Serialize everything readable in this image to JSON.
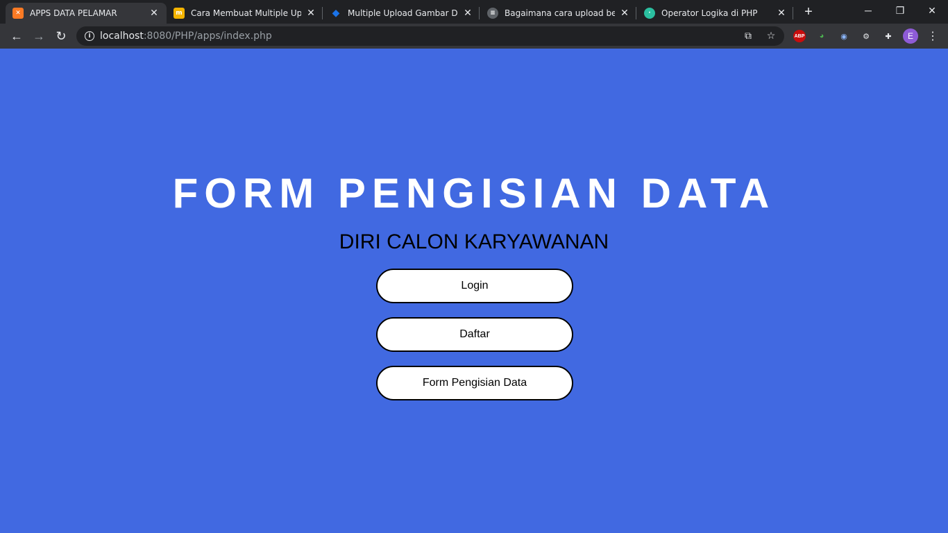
{
  "browser": {
    "tabs": [
      {
        "title": "APPS DATA PELAMAR",
        "favicon": "xampp-icon",
        "color": "#fb7a24",
        "active": true
      },
      {
        "title": "Cara Membuat Multiple Uploa",
        "favicon": "malas-ngoding-icon",
        "color": "#f4b400",
        "active": false
      },
      {
        "title": "Multiple Upload Gambar Deng",
        "favicon": "diamond-icon",
        "color": "#1a73e8",
        "active": false
      },
      {
        "title": "Bagaimana cara upload bebera",
        "favicon": "stackoverflow-icon",
        "color": "#5f6368",
        "active": false
      },
      {
        "title": "Operator Logika di PHP",
        "favicon": "globe-icon",
        "color": "#2bbfa0",
        "active": false
      }
    ],
    "url_host": "localhost",
    "url_path": ":8080/PHP/apps/index.php",
    "profile_initial": "E",
    "abp_label": "ABP"
  },
  "page": {
    "heading": "FORM PENGISIAN DATA",
    "subheading": "DIRI CALON KARYAWANAN",
    "buttons": {
      "login": "Login",
      "daftar": "Daftar",
      "form": "Form Pengisian Data"
    },
    "background": "#4169e1"
  }
}
